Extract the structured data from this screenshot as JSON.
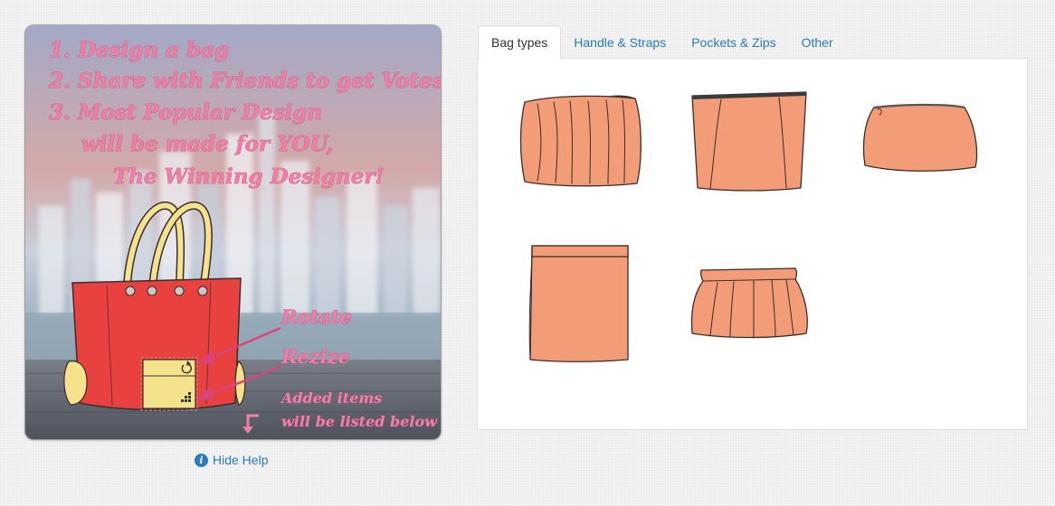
{
  "help": {
    "steps": [
      "1. Design a bag",
      "2. Share with Friends to get Votes",
      "3. Most Popular Design",
      "will be made for YOU,",
      "The Winning Designer!"
    ],
    "rotate_label": "Rotate",
    "resize_label": "Rezize",
    "added_line1": "Added items",
    "added_line2": "will be listed below",
    "hide_help_label": "Hide Help"
  },
  "tabs": [
    {
      "label": "Bag types",
      "active": true
    },
    {
      "label": "Handle & Straps",
      "active": false
    },
    {
      "label": "Pockets & Zips",
      "active": false
    },
    {
      "label": "Other",
      "active": false
    }
  ],
  "bag_types": [
    {
      "icon": "pleated-clutch-bag-icon"
    },
    {
      "icon": "tote-bag-icon"
    },
    {
      "icon": "zip-pouch-bag-icon"
    },
    {
      "icon": "flap-envelope-bag-icon"
    },
    {
      "icon": "frame-clutch-bag-icon"
    }
  ],
  "colors": {
    "accent": "#2a7bc0",
    "bag_fill": "#f29d78",
    "help_text": "#f07fa7",
    "demo_bag": "#e8413f",
    "demo_pocket": "#f5e28c"
  }
}
